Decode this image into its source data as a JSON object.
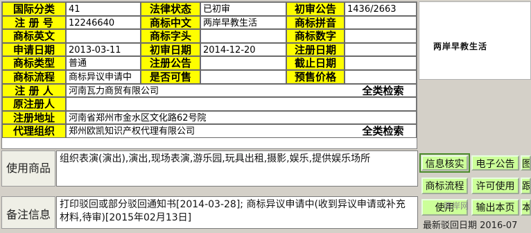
{
  "rows": [
    {
      "c": [
        [
          "国际分类",
          "lbl"
        ],
        [
          "41",
          "val"
        ],
        [
          "法律状态",
          "lbl"
        ],
        [
          "已初审",
          "val"
        ],
        [
          "初审公告",
          "lbl"
        ],
        [
          "1436/2663",
          "val"
        ]
      ]
    },
    {
      "c": [
        [
          "注 册 号",
          "lbl"
        ],
        [
          "12246640",
          "val"
        ],
        [
          "商标中文",
          "lbl"
        ],
        [
          "两岸早教生活",
          "val"
        ],
        [
          "商标拼音",
          "lbl"
        ],
        [
          "",
          "val"
        ]
      ]
    },
    {
      "c": [
        [
          "商标英文",
          "lbl"
        ],
        [
          "",
          "val"
        ],
        [
          "商标字头",
          "lbl"
        ],
        [
          "",
          "val"
        ],
        [
          "商标数字",
          "lbl"
        ],
        [
          "",
          "val"
        ]
      ]
    },
    {
      "c": [
        [
          "申请日期",
          "lbl"
        ],
        [
          "2013-03-11",
          "val"
        ],
        [
          "初审日期",
          "lbl"
        ],
        [
          "2014-12-20",
          "val"
        ],
        [
          "注册日期",
          "lbl"
        ],
        [
          "",
          "val"
        ]
      ]
    },
    {
      "c": [
        [
          "商标类型",
          "lbl"
        ],
        [
          "普通",
          "val"
        ],
        [
          "注册公告",
          "lbl"
        ],
        [
          "",
          "val"
        ],
        [
          "截止日期",
          "lbl"
        ],
        [
          "",
          "val"
        ]
      ]
    },
    {
      "c": [
        [
          "商标流程",
          "lbl"
        ],
        [
          "商标异议申请中",
          "val"
        ],
        [
          "是否可售",
          "lbl"
        ],
        [
          "",
          "val"
        ],
        [
          "预售价格",
          "lbl"
        ],
        [
          "",
          "val"
        ]
      ]
    }
  ],
  "wide_rows": [
    {
      "label": "注 册 人",
      "value": "河南瓦力商贸有限公司",
      "action": "全类检索"
    },
    {
      "label": "原注册人",
      "value": "",
      "action": ""
    },
    {
      "label": "注册地址",
      "value": "河南省郑州市金水区文化路62号院",
      "action": ""
    },
    {
      "label": "代理组织",
      "value": "郑州欧凯知识产权代理有限公司",
      "action": "全类检索"
    }
  ],
  "logo_text": "两岸早教生活",
  "usage": {
    "label": "使用商品",
    "text": "组织表演(演出),演出,现场表演,游乐园,玩具出租,摄影,娱乐,提供娱乐场所"
  },
  "remarks": {
    "label": "备注信息",
    "text": "打印驳回或部分驳回通知书[2014-03-28]; 商标异议申请中(收到异议申请或补充材料,待审)[2015年02月13日]"
  },
  "buttons": {
    "info_check": "信息核实",
    "e_notice": "电子公告",
    "btn_c1": "图",
    "flow": "商标流程",
    "license": "许可使用",
    "btn_c2": "跟",
    "use": "使用",
    "print": "输出本页",
    "btn_c3": "本"
  },
  "watermark": "两岸网",
  "footer": "最新驳回日期 2016-07"
}
